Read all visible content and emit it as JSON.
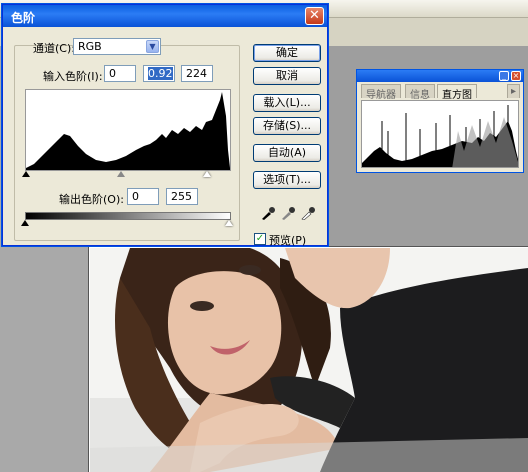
{
  "dialog": {
    "title": "色阶",
    "close_icon": "close-icon",
    "channel_label": "通道(C):",
    "channel_value": "RGB",
    "input_levels_label": "输入色阶(I):",
    "input_levels": [
      "0",
      "0.92",
      "224"
    ],
    "output_levels_label": "输出色阶(O):",
    "output_levels": [
      "0",
      "255"
    ],
    "buttons": {
      "ok": "确定",
      "cancel": "取消",
      "load": "载入(L)...",
      "save": "存储(S)...",
      "auto": "自动(A)",
      "options": "选项(T)..."
    },
    "preview_label": "预览(P)",
    "preview_checked": true,
    "eyedroppers": [
      "black-eyedropper-icon",
      "gray-eyedropper-icon",
      "white-eyedropper-icon"
    ]
  },
  "palette": {
    "tabs": [
      "导航器",
      "信息",
      "直方图"
    ],
    "active_tab": "直方图"
  },
  "colors": {
    "title_blue": "#0a52d6",
    "close_red": "#c5391a",
    "face": "#ece9d8"
  }
}
